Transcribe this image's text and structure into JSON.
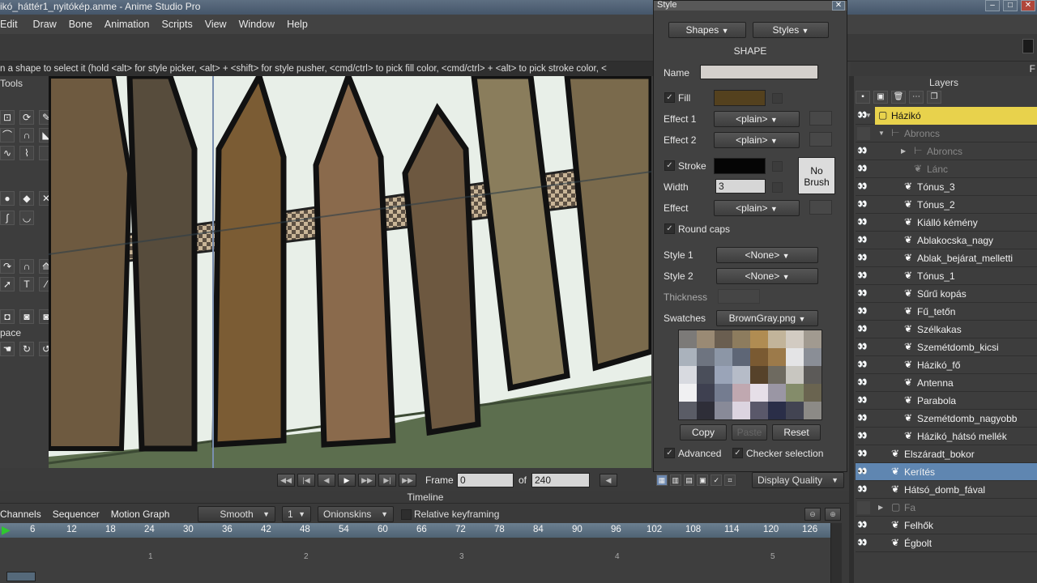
{
  "window": {
    "title": "ikó_háttér1_nyitókép.anme - Anime Studio Pro",
    "controls": [
      "–",
      "□",
      "✕"
    ]
  },
  "menu": [
    "Edit",
    "Draw",
    "Bone",
    "Animation",
    "Scripts",
    "View",
    "Window",
    "Help"
  ],
  "hint": "n a shape to select it (hold <alt> for style picker, <alt> + <shift> for style pusher, <cmd/ctrl> to pick fill color, <cmd/ctrl> + <alt> to pick stroke color, <",
  "tools": {
    "label": "Tools",
    "workspace_label": "pace"
  },
  "playback": {
    "frame_label": "Frame",
    "frame_value": "0",
    "of_label": "of",
    "end_frame": "240",
    "display_quality": "Display Quality"
  },
  "timeline": {
    "title": "Timeline",
    "tabs": [
      "Channels",
      "Sequencer",
      "Motion Graph"
    ],
    "interp": "Smooth",
    "interp_count": "1",
    "onionskins": "Onionskins",
    "relative_keyframing": "Relative keyframing",
    "ruler": [
      "6",
      "12",
      "18",
      "24",
      "30",
      "36",
      "42",
      "48",
      "54",
      "60",
      "66",
      "72",
      "78",
      "84",
      "90",
      "96",
      "102",
      "108",
      "114",
      "120",
      "126"
    ],
    "seconds": [
      "1",
      "2",
      "3",
      "4",
      "5"
    ]
  },
  "style": {
    "title": "Style",
    "tab_shapes": "Shapes",
    "tab_styles": "Styles",
    "section": "SHAPE",
    "name_label": "Name",
    "name_value": "",
    "fill_label": "Fill",
    "fill_color": "#54411e",
    "effect1_label": "Effect 1",
    "effect1_value": "<plain>",
    "effect2_label": "Effect 2",
    "effect2_value": "<plain>",
    "stroke_label": "Stroke",
    "stroke_color": "#050505",
    "no_brush": "No Brush",
    "width_label": "Width",
    "width_value": "3",
    "effect_label": "Effect",
    "effect_value": "<plain>",
    "round_caps": "Round caps",
    "style1_label": "Style 1",
    "style1_value": "<None>",
    "style2_label": "Style 2",
    "style2_value": "<None>",
    "thickness_label": "Thickness",
    "swatches_label": "Swatches",
    "swatches_value": "BrownGray.png",
    "copy": "Copy",
    "paste": "Paste",
    "reset": "Reset",
    "advanced": "Advanced",
    "checker": "Checker selection"
  },
  "layers": {
    "title": "Layers",
    "items": [
      {
        "name": "Házikó"
      },
      {
        "name": "Abroncs"
      },
      {
        "name": "Abroncs"
      },
      {
        "name": "Lánc"
      },
      {
        "name": "Tónus_3"
      },
      {
        "name": "Tónus_2"
      },
      {
        "name": "Kiálló kémény"
      },
      {
        "name": "Ablakocska_nagy"
      },
      {
        "name": "Ablak_bejárat_melletti"
      },
      {
        "name": "Tónus_1"
      },
      {
        "name": "Sűrű kopás"
      },
      {
        "name": "Fű_tetőn"
      },
      {
        "name": "Szélkakas"
      },
      {
        "name": "Szemétdomb_kicsi"
      },
      {
        "name": "Házikó_fő"
      },
      {
        "name": "Antenna"
      },
      {
        "name": "Parabola"
      },
      {
        "name": "Szemétdomb_nagyobb"
      },
      {
        "name": "Házikó_hátsó mellék"
      },
      {
        "name": "Elszáradt_bokor"
      },
      {
        "name": "Kerítés"
      },
      {
        "name": "Hátsó_domb_fával"
      },
      {
        "name": "Fa"
      },
      {
        "name": "Felhők"
      },
      {
        "name": "Égbolt"
      }
    ]
  }
}
